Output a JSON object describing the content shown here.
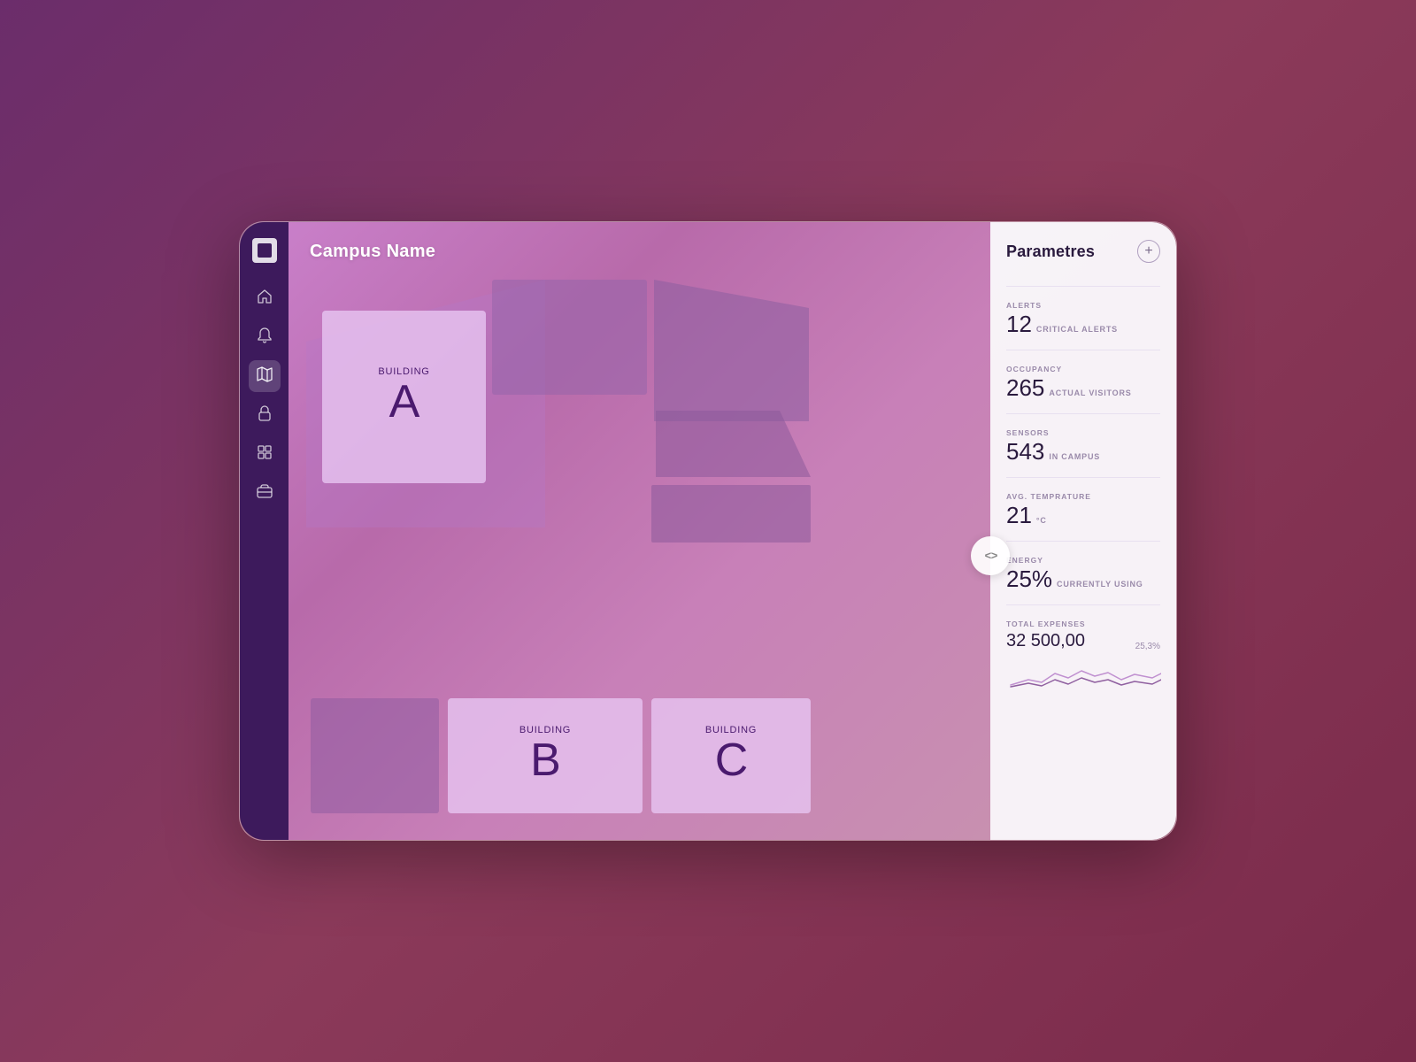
{
  "app": {
    "campus_name": "Campus Name"
  },
  "sidebar": {
    "logo_alt": "App Logo",
    "items": [
      {
        "id": "home",
        "icon": "⌂",
        "label": "Home",
        "active": false
      },
      {
        "id": "notifications",
        "icon": "🔔",
        "label": "Notifications",
        "active": false
      },
      {
        "id": "map",
        "icon": "⊞",
        "label": "Map",
        "active": true
      },
      {
        "id": "security",
        "icon": "🔒",
        "label": "Security",
        "active": false
      },
      {
        "id": "grid",
        "icon": "▦",
        "label": "Grid",
        "active": false
      },
      {
        "id": "briefcase",
        "icon": "💼",
        "label": "Briefcase",
        "active": false
      }
    ]
  },
  "buildings": [
    {
      "id": "A",
      "label": "Building",
      "letter": "A"
    },
    {
      "id": "B",
      "label": "Building",
      "letter": "B"
    },
    {
      "id": "C",
      "label": "Building",
      "letter": "C"
    }
  ],
  "panel": {
    "title": "Parametres",
    "add_button": "+",
    "stats": {
      "alerts": {
        "label": "ALERTS",
        "value": "12",
        "unit": "CRITICAL ALERTS"
      },
      "occupancy": {
        "label": "OCCUPANCY",
        "value": "265",
        "unit": "ACTUAL VISITORS"
      },
      "sensors": {
        "label": "SENSORS",
        "value": "543",
        "unit": "IN CAMPUS"
      },
      "temperature": {
        "label": "AVG. TEMPRATURE",
        "value": "21",
        "unit": "°C"
      },
      "energy": {
        "label": "ENERGY",
        "value": "25%",
        "unit": "CURRENTLY USING"
      },
      "expenses": {
        "label": "TOTAL EXPENSES",
        "value": "32 500,00",
        "percent": "25,3%"
      }
    }
  }
}
